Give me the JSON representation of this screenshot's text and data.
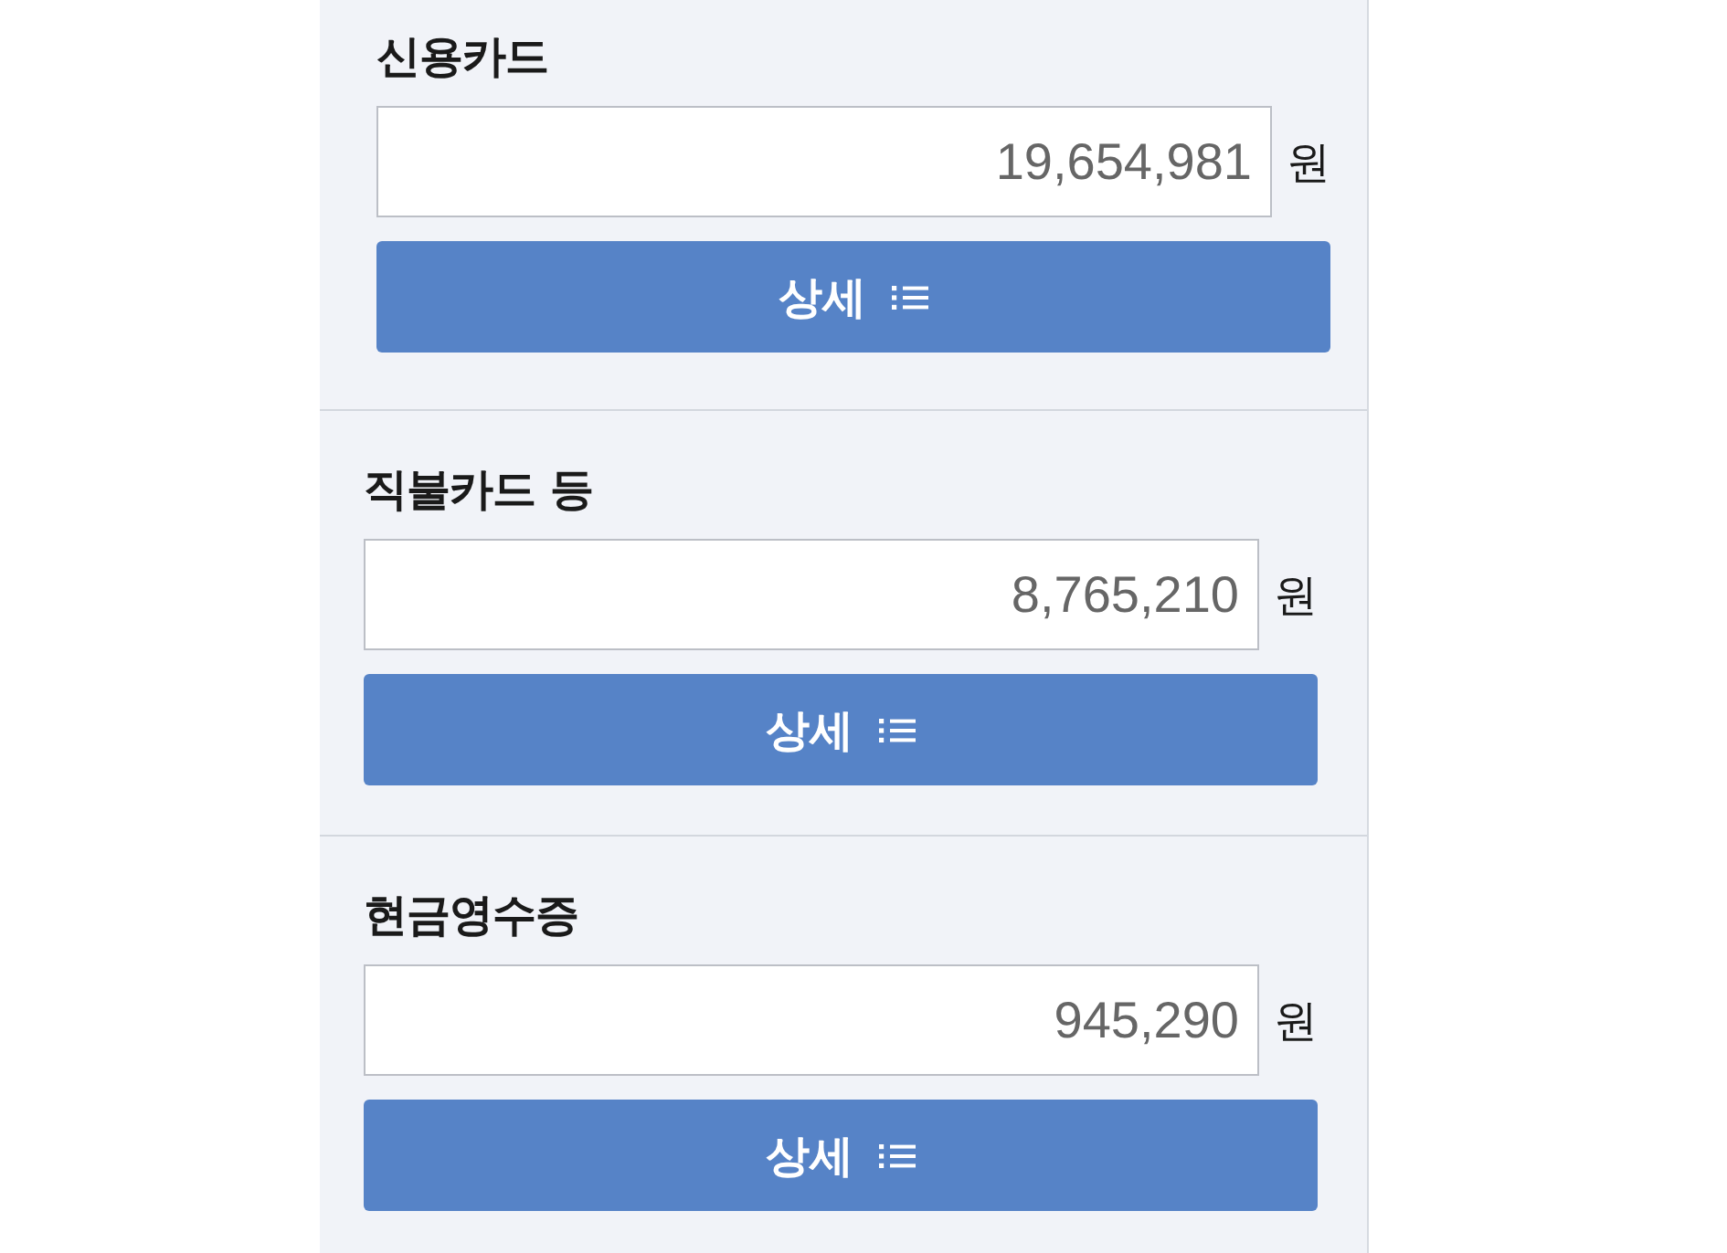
{
  "sections": [
    {
      "label": "신용카드",
      "amount": {
        "value": "19,654,981",
        "unit": "원"
      },
      "button": {
        "label": "상세"
      }
    },
    {
      "label": "직불카드 등",
      "amount": {
        "value": "8,765,210",
        "unit": "원"
      },
      "button": {
        "label": "상세"
      }
    },
    {
      "label": "현금영수증",
      "amount": {
        "value": "945,290",
        "unit": "원"
      },
      "button": {
        "label": "상세"
      }
    }
  ]
}
